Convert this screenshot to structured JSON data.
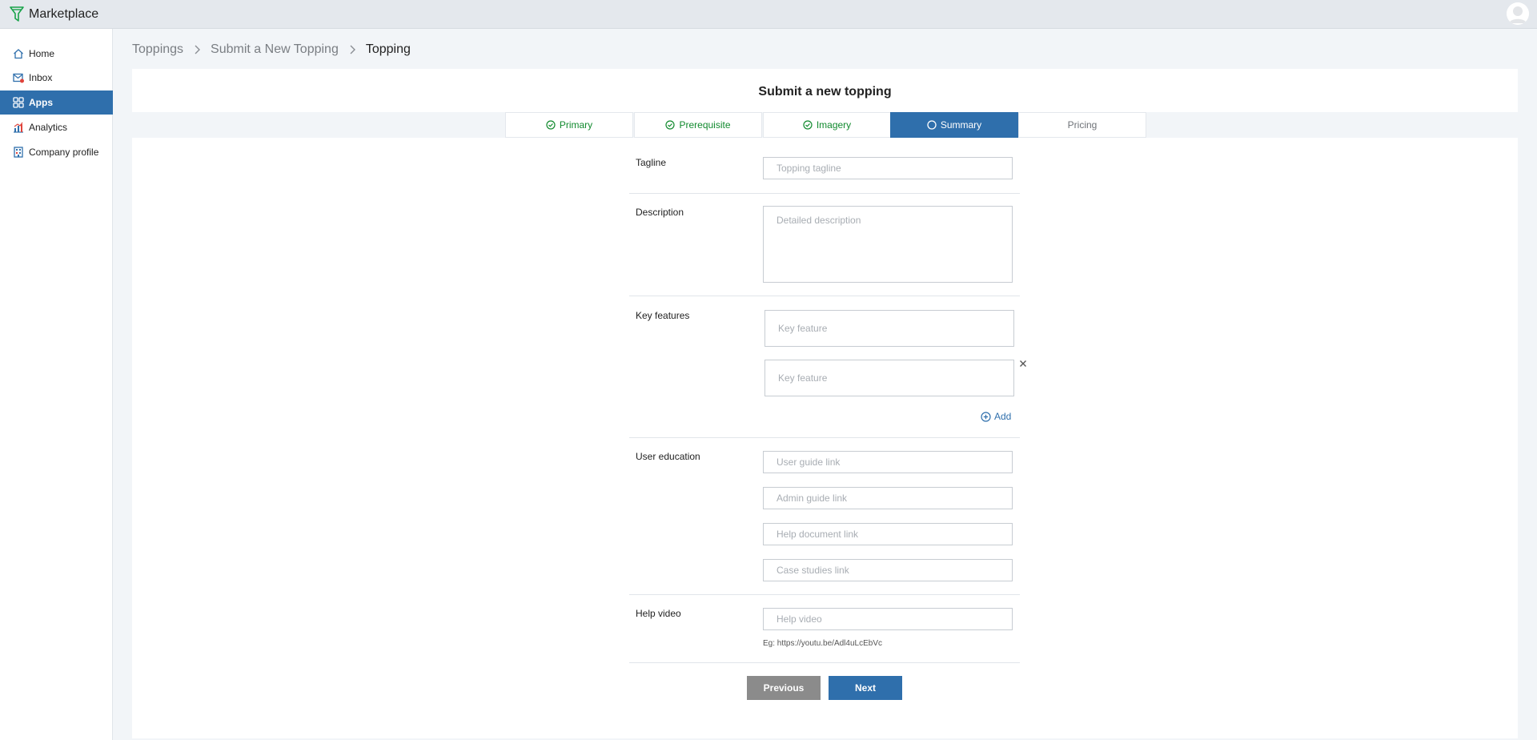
{
  "app": {
    "title": "Marketplace"
  },
  "sidebar": {
    "items": [
      {
        "label": "Home",
        "icon": "home-icon"
      },
      {
        "label": "Inbox",
        "icon": "inbox-icon"
      },
      {
        "label": "Apps",
        "icon": "apps-grid-icon",
        "active": true
      },
      {
        "label": "Analytics",
        "icon": "analytics-icon"
      },
      {
        "label": "Company profile",
        "icon": "company-icon"
      }
    ]
  },
  "breadcrumb": [
    "Toppings",
    "Submit a New Topping",
    "Topping"
  ],
  "form": {
    "title": "Submit a new topping",
    "tabs": [
      {
        "label": "Primary",
        "status": "complete"
      },
      {
        "label": "Prerequisite",
        "status": "complete"
      },
      {
        "label": "Imagery",
        "status": "complete"
      },
      {
        "label": "Summary",
        "status": "current"
      },
      {
        "label": "Pricing",
        "status": "pending"
      }
    ],
    "tagline": {
      "label": "Tagline",
      "placeholder": "Topping tagline",
      "value": ""
    },
    "description": {
      "label": "Description",
      "placeholder": "Detailed description",
      "value": ""
    },
    "key_features": {
      "label": "Key features",
      "items": [
        {
          "placeholder": "Key feature",
          "value": ""
        },
        {
          "placeholder": "Key feature",
          "value": ""
        }
      ],
      "add_label": "Add"
    },
    "user_education": {
      "label": "User education",
      "user_guide_placeholder": "User guide link",
      "admin_guide_placeholder": "Admin guide link",
      "help_doc_placeholder": "Help document link",
      "case_studies_placeholder": "Case studies link"
    },
    "help_video": {
      "label": "Help video",
      "placeholder": "Help video",
      "hint": "Eg: https://youtu.be/Adl4uLcEbVc"
    },
    "buttons": {
      "previous": "Previous",
      "next": "Next"
    }
  },
  "colors": {
    "accent": "#2f6fac",
    "complete": "#118a2e",
    "pending": "#6f7378",
    "previous_button": "#8b8b8b"
  }
}
